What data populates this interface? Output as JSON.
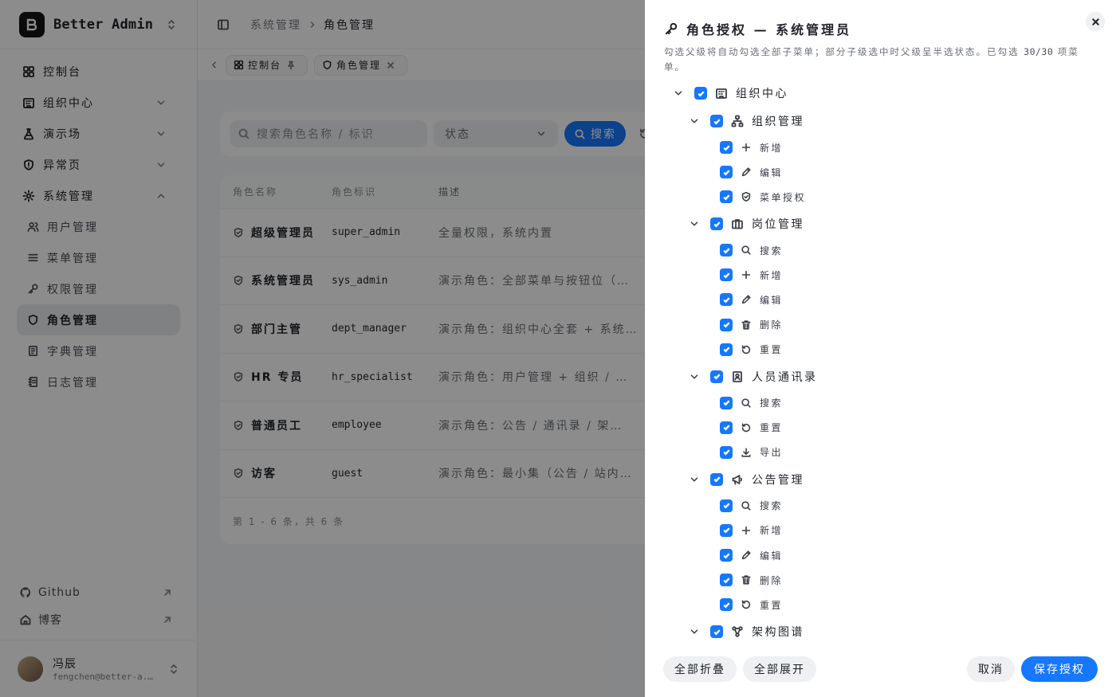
{
  "brand": {
    "name": "Better Admin"
  },
  "sidebar": {
    "items": [
      {
        "label": "控制台"
      },
      {
        "label": "组织中心"
      },
      {
        "label": "演示场"
      },
      {
        "label": "异常页"
      },
      {
        "label": "系统管理"
      }
    ],
    "sub_items": [
      {
        "label": "用户管理"
      },
      {
        "label": "菜单管理"
      },
      {
        "label": "权限管理"
      },
      {
        "label": "角色管理"
      },
      {
        "label": "字典管理"
      },
      {
        "label": "日志管理"
      }
    ],
    "github": "Github",
    "blog": "博客",
    "user": {
      "name": "冯辰",
      "email": "fengchen@better-a..."
    }
  },
  "header": {
    "breadcrumb": [
      "系统管理",
      "角色管理"
    ]
  },
  "tabs": [
    {
      "label": "控制台"
    },
    {
      "label": "角色管理"
    }
  ],
  "filters": {
    "search_placeholder": "搜索角色名称 / 标识",
    "status_placeholder": "状态",
    "search_button": "搜索"
  },
  "table": {
    "headers": [
      "角色名称",
      "角色标识",
      "描述"
    ],
    "rows": [
      {
        "name": "超级管理员",
        "code": "super_admin",
        "desc": "全量权限，系统内置"
      },
      {
        "name": "系统管理员",
        "code": "sys_admin",
        "desc": "演示角色：全部菜单与按钮位（…"
      },
      {
        "name": "部门主管",
        "code": "dept_manager",
        "desc": "演示角色：组织中心全套 + 系统…"
      },
      {
        "name": "HR 专员",
        "code": "hr_specialist",
        "desc": "演示角色：用户管理 + 组织 / …"
      },
      {
        "name": "普通员工",
        "code": "employee",
        "desc": "演示角色：公告 / 通讯录 / 架…"
      },
      {
        "name": "访客",
        "code": "guest",
        "desc": "演示角色：最小集（公告 / 站内…"
      }
    ],
    "pagination": "第 1 - 6 条，共 6 条"
  },
  "drawer": {
    "title": "角色授权 — 系统管理员",
    "desc_prefix": "勾选父级将自动勾选全部子菜单；部分子级选中时父级呈半选状态。已勾选 ",
    "desc_count": "30/30",
    "desc_suffix": " 项菜单。",
    "tree": [
      {
        "label": "组织中心",
        "level": 0,
        "icon": "building-icon",
        "toggle": true
      },
      {
        "label": "组织管理",
        "level": 1,
        "icon": "org-chart-icon",
        "toggle": true
      },
      {
        "label": "新增",
        "level": 2,
        "icon": "plus-icon"
      },
      {
        "label": "编辑",
        "level": 2,
        "icon": "pencil-icon"
      },
      {
        "label": "菜单授权",
        "level": 2,
        "icon": "shield-icon"
      },
      {
        "label": "岗位管理",
        "level": 1,
        "icon": "briefcase-icon",
        "toggle": true
      },
      {
        "label": "搜索",
        "level": 2,
        "icon": "search-icon"
      },
      {
        "label": "新增",
        "level": 2,
        "icon": "plus-icon"
      },
      {
        "label": "编辑",
        "level": 2,
        "icon": "pencil-icon"
      },
      {
        "label": "删除",
        "level": 2,
        "icon": "trash-icon"
      },
      {
        "label": "重置",
        "level": 2,
        "icon": "reset-icon"
      },
      {
        "label": "人员通讯录",
        "level": 1,
        "icon": "contact-book-icon",
        "toggle": true
      },
      {
        "label": "搜索",
        "level": 2,
        "icon": "search-icon"
      },
      {
        "label": "重置",
        "level": 2,
        "icon": "reset-icon"
      },
      {
        "label": "导出",
        "level": 2,
        "icon": "download-icon"
      },
      {
        "label": "公告管理",
        "level": 1,
        "icon": "megaphone-icon",
        "toggle": true
      },
      {
        "label": "搜索",
        "level": 2,
        "icon": "search-icon"
      },
      {
        "label": "新增",
        "level": 2,
        "icon": "plus-icon"
      },
      {
        "label": "编辑",
        "level": 2,
        "icon": "pencil-icon"
      },
      {
        "label": "删除",
        "level": 2,
        "icon": "trash-icon"
      },
      {
        "label": "重置",
        "level": 2,
        "icon": "reset-icon"
      },
      {
        "label": "架构图谱",
        "level": 1,
        "icon": "graph-icon",
        "toggle": true
      }
    ],
    "collapse_all": "全部折叠",
    "expand_all": "全部展开",
    "cancel": "取消",
    "save": "保存授权"
  },
  "colors": {
    "accent": "#1677ff",
    "overlay": "rgba(0,0,0,0.45)"
  }
}
